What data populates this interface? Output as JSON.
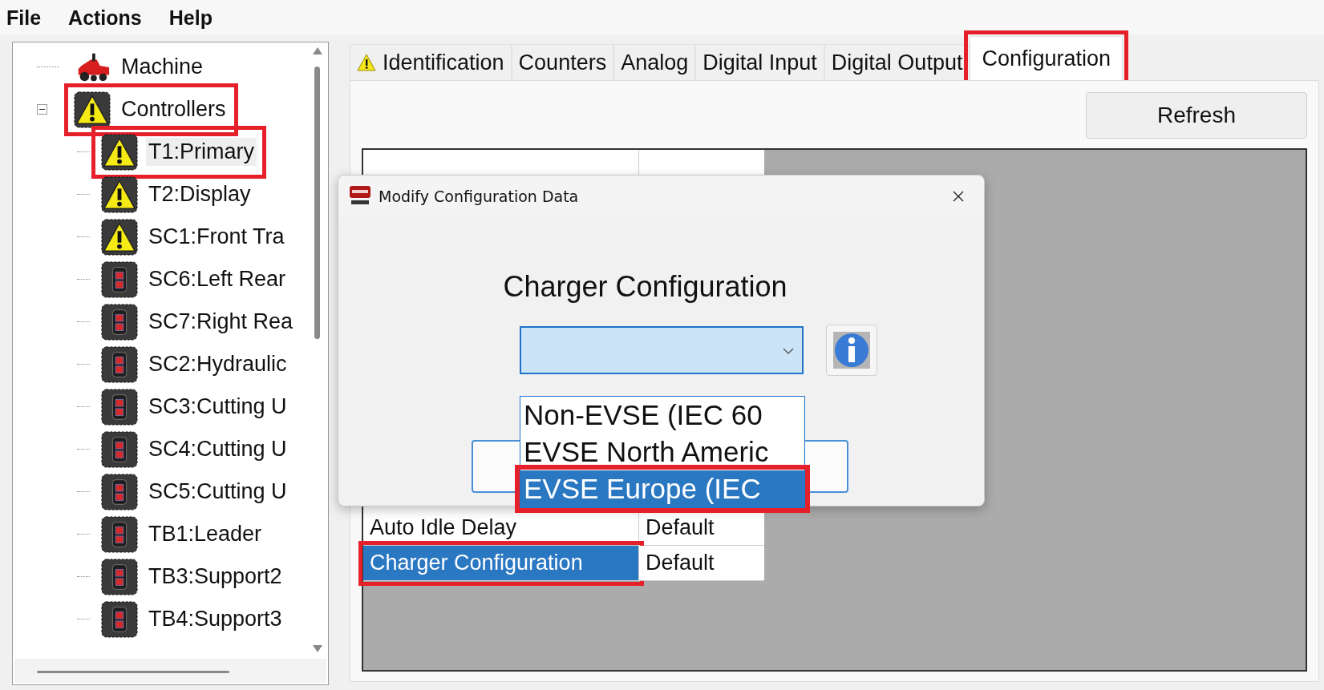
{
  "menu": [
    {
      "label": "File"
    },
    {
      "label": "Actions"
    },
    {
      "label": "Help"
    }
  ],
  "tree": [
    {
      "label": "Machine",
      "kind": "machine",
      "selected": false,
      "highlighted": false
    },
    {
      "label": "Controllers",
      "kind": "warning",
      "selected": false,
      "highlighted": true,
      "expanded": true,
      "children": [
        {
          "label": "T1:Primary",
          "kind": "warning",
          "selected": true,
          "highlighted": true
        },
        {
          "label": "T2:Display",
          "kind": "warning",
          "selected": false,
          "highlighted": false
        },
        {
          "label": "SC1:Front Tra",
          "kind": "warning",
          "selected": false,
          "highlighted": false
        },
        {
          "label": "SC6:Left Rear",
          "kind": "module",
          "selected": false,
          "highlighted": false
        },
        {
          "label": "SC7:Right Rea",
          "kind": "module",
          "selected": false,
          "highlighted": false
        },
        {
          "label": "SC2:Hydraulic",
          "kind": "module",
          "selected": false,
          "highlighted": false
        },
        {
          "label": "SC3:Cutting U",
          "kind": "module",
          "selected": false,
          "highlighted": false
        },
        {
          "label": "SC4:Cutting U",
          "kind": "module",
          "selected": false,
          "highlighted": false
        },
        {
          "label": "SC5:Cutting U",
          "kind": "module",
          "selected": false,
          "highlighted": false
        },
        {
          "label": "TB1:Leader",
          "kind": "module",
          "selected": false,
          "highlighted": false
        },
        {
          "label": "TB3:Support2",
          "kind": "module",
          "selected": false,
          "highlighted": false
        },
        {
          "label": "TB4:Support3",
          "kind": "module",
          "selected": false,
          "highlighted": false
        }
      ]
    }
  ],
  "tabs": [
    {
      "label": "Identification",
      "warning": true,
      "selected": false,
      "highlighted": false
    },
    {
      "label": "Counters",
      "warning": false,
      "selected": false,
      "highlighted": false
    },
    {
      "label": "Analog",
      "warning": false,
      "selected": false,
      "highlighted": false
    },
    {
      "label": "Digital Input",
      "warning": false,
      "selected": false,
      "highlighted": false
    },
    {
      "label": "Digital Output",
      "warning": false,
      "selected": false,
      "highlighted": false
    },
    {
      "label": "Configuration",
      "warning": false,
      "selected": true,
      "highlighted": true
    }
  ],
  "refresh_button": "Refresh",
  "table": {
    "rows": [
      {
        "description": "Auto Idle Delay",
        "value": "Default",
        "selected": false,
        "highlighted": false
      },
      {
        "description": "Charger Configuration",
        "value": "Default",
        "selected": true,
        "highlighted": true
      }
    ]
  },
  "dialog": {
    "title": "Modify Configuration Data",
    "heading": "Charger Configuration",
    "dropdown": {
      "options": [
        {
          "label": "Non-EVSE (IEC 60",
          "selected": false,
          "highlighted": false
        },
        {
          "label": "EVSE North Americ",
          "selected": false,
          "highlighted": false
        },
        {
          "label": "EVSE Europe (IEC",
          "selected": true,
          "highlighted": true
        }
      ]
    }
  }
}
